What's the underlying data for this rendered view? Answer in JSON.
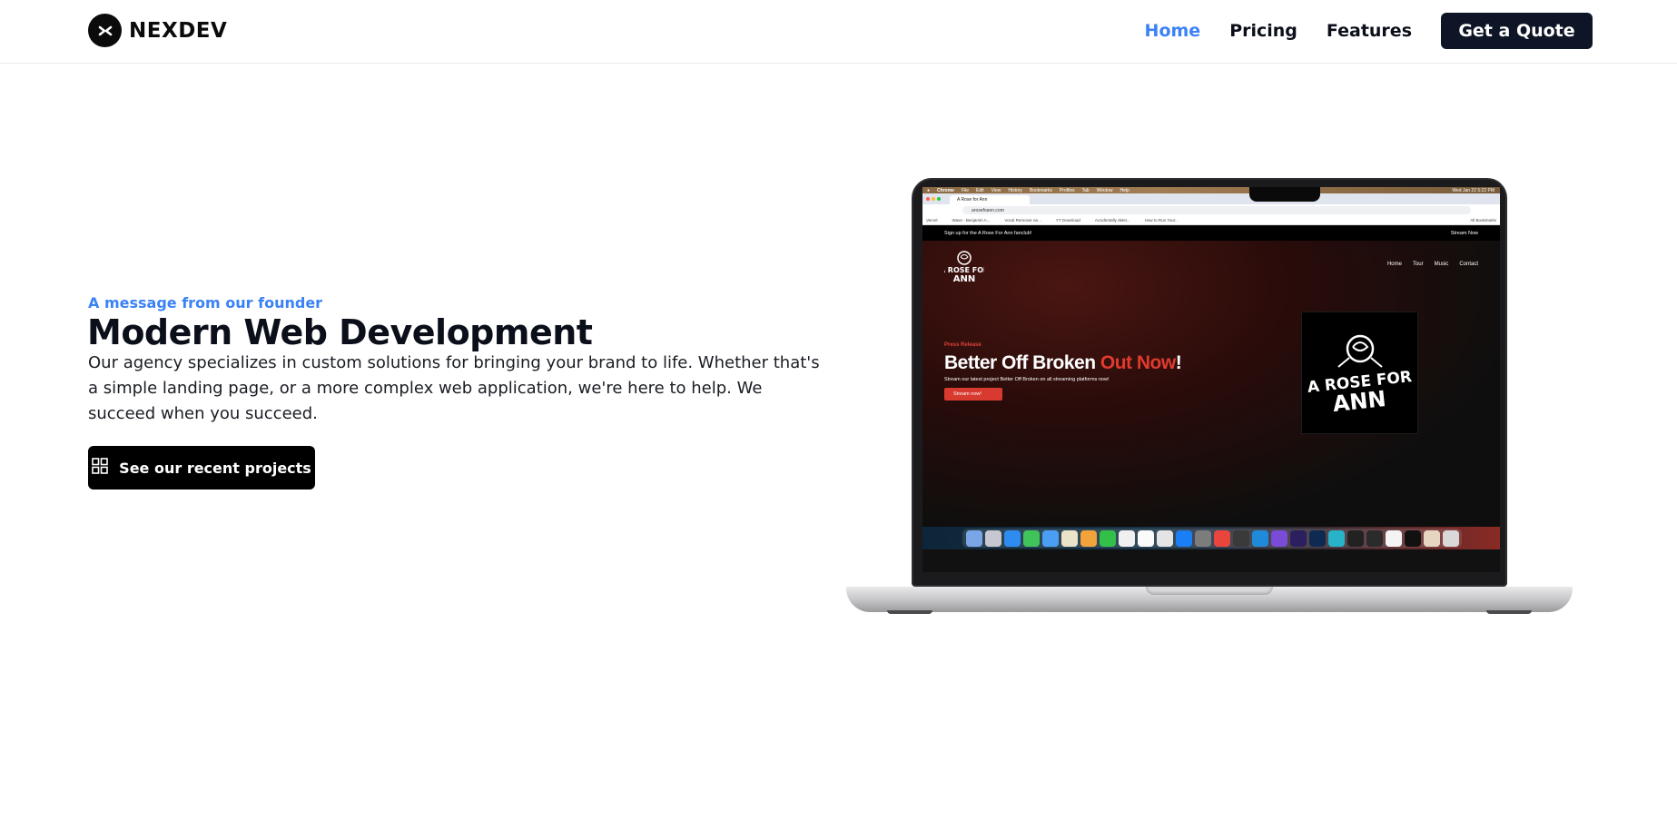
{
  "brand": {
    "name": "NEXDEV",
    "icon": "chevrons-icon"
  },
  "nav": {
    "links": [
      "Home",
      "Pricing",
      "Features"
    ],
    "active": "Home",
    "cta": "Get a Quote"
  },
  "hero": {
    "eyebrow": "A message from our founder",
    "title": "Modern Web Development",
    "description": "Our agency specializes in custom solutions for bringing your brand to life. Whether that's a simple landing page, or a more complex web application, we're here to help. We succeed when you succeed.",
    "button_label": "See our recent projects",
    "button_icon": "grid-icon"
  },
  "mockup": {
    "mac_menu": [
      "Chrome",
      "File",
      "Edit",
      "View",
      "History",
      "Bookmarks",
      "Profiles",
      "Tab",
      "Window",
      "Help"
    ],
    "clock": "Wed Jan 22 5:22 PM",
    "tab_title": "A Rose for Ann",
    "url": "arosefoann.com",
    "bookmarks": [
      "Vercel",
      "Wave - Benjamin A...",
      "Vocal Remover an...",
      "YT Download",
      "Accidentally delet...",
      "How to Run Your..."
    ],
    "all_bookmarks": "All Bookmarks",
    "site": {
      "topbar_left": "Sign up for the A Rose For Ann fanclub!",
      "topbar_right": "Stream Now",
      "logo_text": "A ROSE FOR ANN",
      "nav": [
        "Home",
        "Tour",
        "Music",
        "Contact"
      ],
      "kicker": "Press Release",
      "headline_white": "Better Off Broken ",
      "headline_red": "Out Now",
      "headline_end": "!",
      "subtext": "Stream our latest project Better Off Broken on all streaming platforms now!",
      "button": "Stream now!",
      "album_text": "A ROSE FOR ANN"
    }
  },
  "colors": {
    "accent": "#3b82f6",
    "dark": "#0e1526",
    "site_red": "#e13a2e"
  }
}
